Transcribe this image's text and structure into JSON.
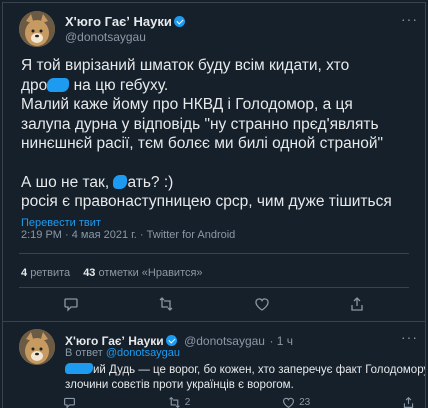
{
  "tweet": {
    "author_name": "Х'юго Гаєʼ Науки",
    "author_handle": "@donotsaygau",
    "lines": [
      {
        "pre": "Я той вирізаний шматок буду всім кидати, хто",
        "post": ""
      },
      {
        "pre": "дро",
        "post": " на цю гебуху."
      },
      {
        "pre": "Малий каже йому про НКВД і Голодомор, а ця",
        "post": ""
      },
      {
        "pre": "залупа дурна у відповідь \"ну странно прєд'являть",
        "post": ""
      },
      {
        "pre": "нинєшнєй расії, тєм болєє ми билі одной страной\"",
        "post": ""
      },
      {
        "pre": "",
        "post": ""
      },
      {
        "pre": "А шо не так, ",
        "post": "ать? :)"
      },
      {
        "pre": "росія є правонаступницею срср, чим дуже тішиться",
        "post": ""
      }
    ],
    "translate_link": "Перевести твит",
    "timestamp": "2:19 PM · 4 мая 2021 г. · Twitter for Android",
    "retweets_count": "4",
    "retweets_label": "ретвита",
    "likes_count": "43",
    "likes_label": "отметки «Нравится»"
  },
  "reply": {
    "author_name": "Х'юго Гаєʼ Науки",
    "author_handle": "@donotsaygau",
    "time": "· 1 ч",
    "in_reply_prefix": "В ответ ",
    "in_reply_handle": "@donotsaygau",
    "line1_post": "ий Дудь — це ворог, бо кожен, хто заперечує факт Голодомору і",
    "line2": "злочини совєтів проти українців є ворогом.",
    "retweet_count": "2",
    "like_count": "23"
  },
  "icons": [
    "verified-icon",
    "more-icon",
    "reply-icon",
    "retweet-icon",
    "like-icon",
    "share-icon"
  ],
  "colors": {
    "background": "#15202b",
    "accent": "#1d9bf0",
    "muted": "#8b98a5",
    "text": "#e7e9ea",
    "border": "#38444d"
  }
}
